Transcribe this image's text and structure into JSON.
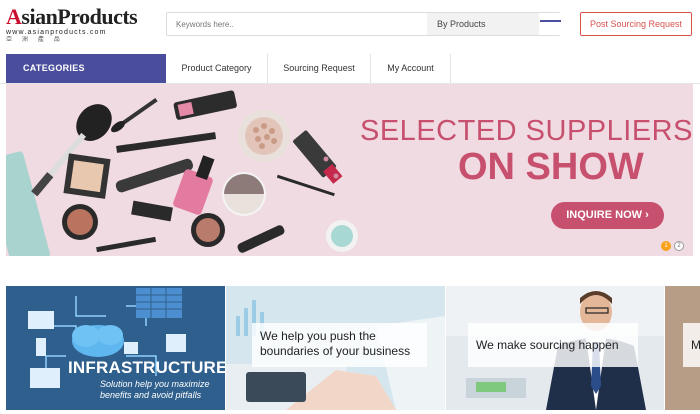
{
  "header": {
    "logo": {
      "main": "AsianProducts",
      "url": "www.asianproducts.com",
      "cn": "亞 洲 產 品"
    },
    "search": {
      "placeholder": "Keywords here..",
      "scope": "By Products"
    },
    "post_button": "Post Sourcing Request"
  },
  "nav": {
    "categories": "CATEGORIES",
    "items": [
      {
        "label": "Product Category"
      },
      {
        "label": "Sourcing Request"
      },
      {
        "label": "My Account"
      }
    ]
  },
  "banner": {
    "headline_line1": "SELECTED SUPPLIERS",
    "headline_line2": "ON SHOW",
    "cta": "INQUIRE NOW ›",
    "slides": [
      "1",
      "2"
    ],
    "active_slide": 1,
    "accent_color": "#c7506e"
  },
  "tiles": [
    {
      "title": "INFRASTRUCTURE",
      "subtitle_line1": "Solution help you maximize",
      "subtitle_line2": "benefits and avoid pitfalls"
    },
    {
      "caption_line1": "We help you push the",
      "caption_line2": "boundaries of your business"
    },
    {
      "caption": "We make sourcing happen"
    },
    {
      "caption": "M"
    }
  ],
  "colors": {
    "brand_purple": "#4a4d9c",
    "post_red": "#d9534f",
    "slide_active": "#f7a21a"
  }
}
